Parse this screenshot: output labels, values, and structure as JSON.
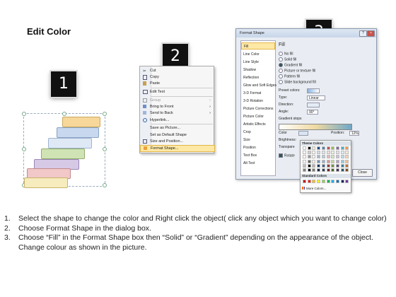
{
  "title": "Edit Color",
  "badges": [
    "1",
    "2",
    "3"
  ],
  "context_menu": {
    "items": [
      {
        "label": "Cut",
        "icon": "scissors-icon"
      },
      {
        "label": "Copy",
        "icon": "copy-icon"
      },
      {
        "label": "Paste",
        "icon": "paste-icon"
      },
      {
        "label": "Edit Text",
        "icon": "edit-text-icon"
      },
      {
        "label": "Group",
        "icon": "group-icon",
        "disabled": true,
        "submenu": true
      },
      {
        "label": "Bring to Front",
        "icon": "bring-front-icon",
        "submenu": true
      },
      {
        "label": "Send to Back",
        "icon": "send-back-icon",
        "submenu": true
      },
      {
        "label": "Hyperlink...",
        "icon": "hyperlink-icon"
      },
      {
        "label": "Save as Picture...",
        "icon": "save-picture-icon"
      },
      {
        "label": "Set as Default Shape",
        "icon": "default-shape-icon"
      },
      {
        "label": "Size and Position...",
        "icon": "size-position-icon"
      },
      {
        "label": "Format Shape...",
        "icon": "format-shape-icon",
        "highlighted": true
      }
    ]
  },
  "dialog": {
    "title": "Format Shape",
    "help": "?",
    "close": "×",
    "nav": [
      "Fill",
      "Line Color",
      "Line Style",
      "Shadow",
      "Reflection",
      "Glow and Soft Edges",
      "3-D Format",
      "3-D Rotation",
      "Picture Corrections",
      "Picture Color",
      "Artistic Effects",
      "Crop",
      "Size",
      "Position",
      "Text Box",
      "Alt Text"
    ],
    "pane_title": "Fill",
    "fill_options": [
      {
        "label": "No fill",
        "selected": false
      },
      {
        "label": "Solid fill",
        "selected": false
      },
      {
        "label": "Gradient fill",
        "selected": true
      },
      {
        "label": "Picture or texture fill",
        "selected": false
      },
      {
        "label": "Pattern fill",
        "selected": false
      },
      {
        "label": "Slide background fill",
        "selected": false
      }
    ],
    "preset_colors_label": "Preset colors:",
    "type_label": "Type:",
    "type_value": "Linear",
    "direction_label": "Direction:",
    "angle_label": "Angle:",
    "angle_value": "90°",
    "gradient_stops_label": "Gradient stops",
    "color_label": "Color",
    "position_label": "Position:",
    "position_value": "12%",
    "brightness_label": "Brightness:",
    "transparency_label": "Transpare",
    "rotate_label": "Rotate",
    "close_button": "Close"
  },
  "palette": {
    "theme_label": "Theme Colors",
    "standard_label": "Standard Colors",
    "more_label": "More Colors...",
    "theme_top": [
      "#ffffff",
      "#000000",
      "#eeece1",
      "#1f497d",
      "#4f81bd",
      "#c0504d",
      "#9bbb59",
      "#8064a2",
      "#4bacc6",
      "#f79646"
    ],
    "standard": [
      "#c00000",
      "#ff0000",
      "#ffc000",
      "#ffff00",
      "#92d050",
      "#00b050",
      "#00b0f0",
      "#0070c0",
      "#002060",
      "#7030a0"
    ]
  },
  "shapes": {
    "colors": [
      "#f7d89a",
      "#c7d8ef",
      "#dfe9f6",
      "#cfe3b5",
      "#d6c9e6",
      "#f2c8c8",
      "#f6ecbd"
    ]
  },
  "instructions": [
    {
      "num": "1.",
      "text": "Select the shape to change the color and Right click the object( click any object which you want to change color)"
    },
    {
      "num": "2.",
      "text": "Choose Format Shape in the dialog box."
    },
    {
      "num": "3.",
      "text": "Choose “Fill” in the Format Shape box then “Solid” or “Gradient” depending on the appearance of the object. Change colour as shown in the picture."
    }
  ]
}
